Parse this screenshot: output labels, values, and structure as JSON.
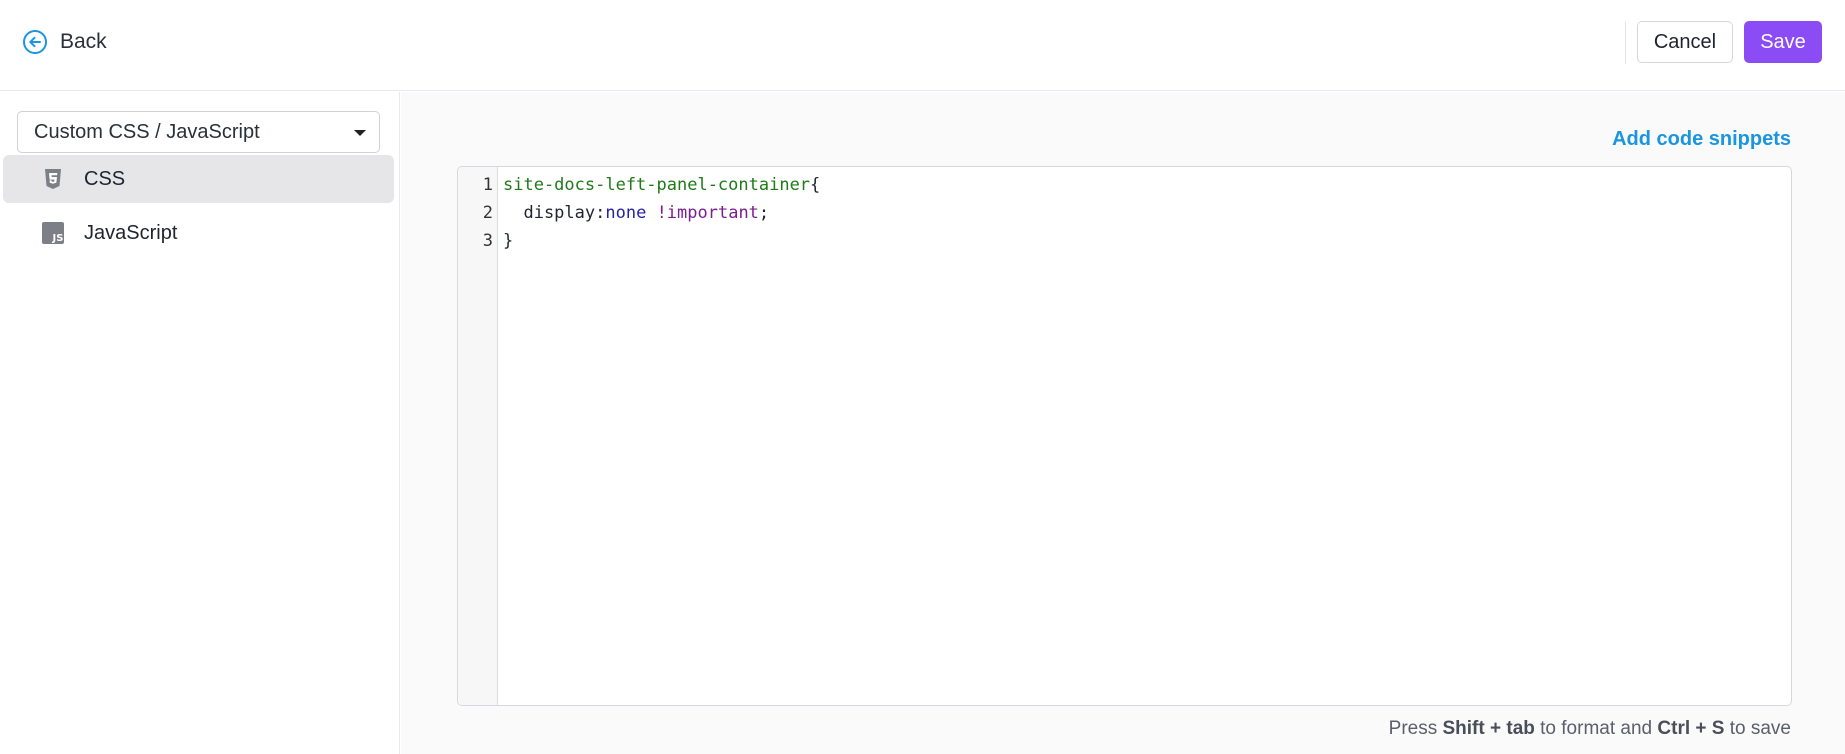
{
  "header": {
    "back_label": "Back",
    "cancel_label": "Cancel",
    "save_label": "Save"
  },
  "sidebar": {
    "select_value": "Custom CSS / JavaScript",
    "items": [
      {
        "label": "CSS",
        "icon": "css3-icon",
        "active": true
      },
      {
        "label": "JavaScript",
        "icon": "js-icon",
        "active": false
      }
    ]
  },
  "main": {
    "add_snippets_label": "Add code snippets",
    "editor": {
      "line_numbers": [
        "1",
        "2",
        "3"
      ],
      "code": {
        "line1_selector": "site-docs-left-panel-container",
        "line1_brace": "{",
        "line2_prop": "  display:",
        "line2_value": "none",
        "line2_space": " ",
        "line2_important": "!important",
        "line2_semicolon": ";",
        "line3_brace": "}"
      }
    },
    "hint": {
      "t1": "Press ",
      "k1": "Shift + tab",
      "t2": " to format and ",
      "k2": "Ctrl + S",
      "t3": " to save"
    }
  },
  "colors": {
    "accent": "#8b4cf6",
    "link": "#1a95e0",
    "selector": "#1f7a18",
    "value": "#2622a8",
    "important": "#7a1f8f"
  }
}
